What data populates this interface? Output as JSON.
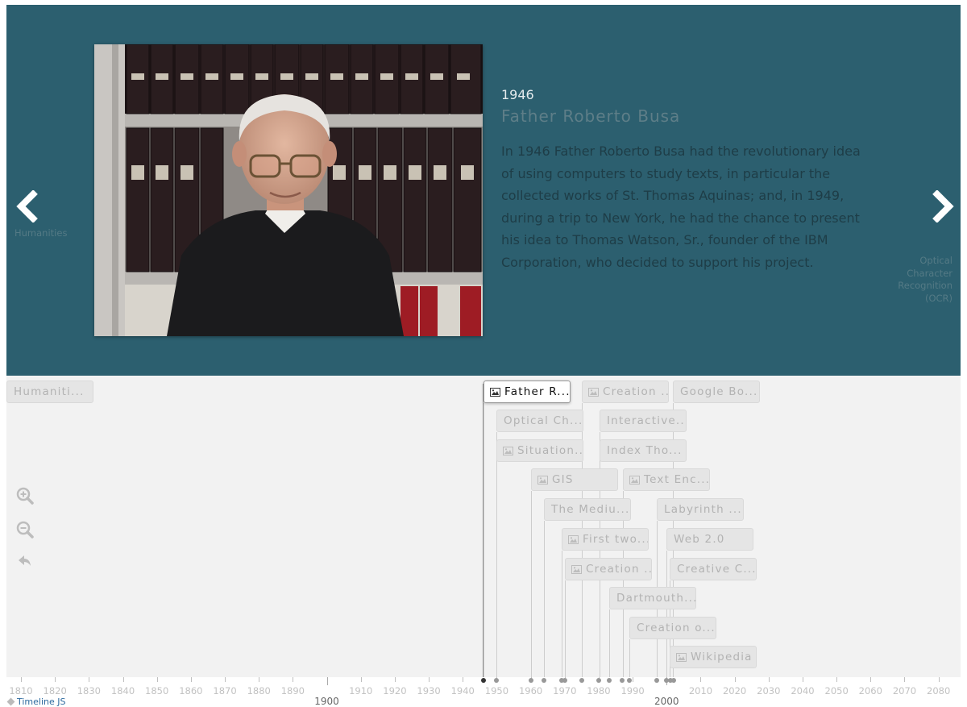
{
  "slide": {
    "date": "1946",
    "title": "Father Roberto Busa",
    "text": "In 1946 Father Roberto Busa had the revolutionary idea of using computers to study texts, in particular the collected works of St. Thomas Aquinas; and, in 1949, during a trip to New York, he had the chance to present his idea to Thomas Watson, Sr., founder of the IBM Corporation, who decided to support his project."
  },
  "nav": {
    "prev_label": "Humanities",
    "next_label": "Optical Character Recognition (OCR)"
  },
  "flags": [
    {
      "label": "Humaniti...",
      "media": false
    },
    {
      "label": "Father R...",
      "media": true,
      "active": true
    },
    {
      "label": "Creation ...",
      "media": true
    },
    {
      "label": "Google Bo...",
      "media": false
    },
    {
      "label": "Optical Ch...",
      "media": false
    },
    {
      "label": "Interactive...",
      "media": false
    },
    {
      "label": "Situation...",
      "media": true
    },
    {
      "label": "Index Tho...",
      "media": false
    },
    {
      "label": "GIS",
      "media": true
    },
    {
      "label": "Text Enc...",
      "media": true
    },
    {
      "label": "The Mediu...",
      "media": false
    },
    {
      "label": "Labyrinth ...",
      "media": false
    },
    {
      "label": "First two...",
      "media": true
    },
    {
      "label": "Web 2.0",
      "media": false
    },
    {
      "label": "Creation ...",
      "media": true
    },
    {
      "label": "Creative C...",
      "media": false
    },
    {
      "label": "Dartmouth...",
      "media": false
    },
    {
      "label": "Creation o...",
      "media": false
    },
    {
      "label": "Wikipedia",
      "media": true
    }
  ],
  "axis": {
    "minor_labels": [
      "1810",
      "1820",
      "1830",
      "1840",
      "1850",
      "1860",
      "1870",
      "1880",
      "1890",
      "1910",
      "1920",
      "1930",
      "1940",
      "1950",
      "1960",
      "1970",
      "1980",
      "1990",
      "2010",
      "2020",
      "2030",
      "2040",
      "2050",
      "2060",
      "2070",
      "2080"
    ],
    "major_labels": [
      "1900",
      "2000"
    ],
    "event_years": [
      1946,
      1950,
      1960,
      1964,
      1969,
      1970,
      1975,
      1980,
      1983,
      1987,
      1989,
      1997,
      2000,
      2001,
      2002
    ]
  },
  "icons": {
    "zoom_in": "zoom-in-icon",
    "zoom_out": "zoom-out-icon",
    "back": "back-to-start-icon",
    "prev": "chevron-left-icon",
    "next": "chevron-right-icon"
  },
  "brand": {
    "label": "Timeline JS"
  },
  "colors": {
    "stage_bg": "#2c5f6f",
    "navbar_bg": "#f2f2f2"
  }
}
